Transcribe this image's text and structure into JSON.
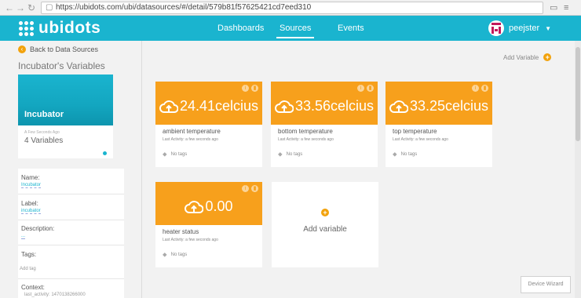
{
  "browser": {
    "url": "https://ubidots.com/ubi/datasources/#/detail/579b81f57625421cd7eed310"
  },
  "header": {
    "logo_text": "ubidots",
    "nav": [
      "Dashboards",
      "Sources",
      "Events"
    ],
    "active_nav": "Sources",
    "user": "peejster",
    "brand_color": "#1ab4cf",
    "accent_color": "#f7a01c"
  },
  "left": {
    "back_label": "Back to Data Sources",
    "title": "Incubator's Variables",
    "datasource": {
      "name": "Incubator",
      "ago": "A Few Seconds Ago",
      "count": "4 Variables"
    },
    "props": {
      "name_label": "Name:",
      "name_value": "Incubator",
      "label_label": "Label:",
      "label_value": "incubator",
      "desc_label": "Description:",
      "desc_value": "...",
      "tags_label": "Tags:",
      "tags_value": "Add tag",
      "context_label": "Context:",
      "context_value": "last_activity: 1470138266000"
    }
  },
  "content": {
    "add_variable_label": "Add Variable",
    "variables": [
      {
        "value": "24.41",
        "unit": "celcius",
        "name": "ambient temperature",
        "activity": "Last Activity: a few seconds ago",
        "tags": "No tags"
      },
      {
        "value": "33.56",
        "unit": "celcius",
        "name": "bottom temperature",
        "activity": "Last Activity: a few seconds ago",
        "tags": "No tags"
      },
      {
        "value": "33.25",
        "unit": "celcius",
        "name": "top temperature",
        "activity": "Last Activity: a few seconds ago",
        "tags": "No tags"
      },
      {
        "value": "0.00",
        "unit": "",
        "name": "heater status",
        "activity": "Last Activity: a few seconds ago",
        "tags": "No tags"
      }
    ],
    "add_card_label": "Add variable",
    "wizard_label": "Device Wizard"
  }
}
